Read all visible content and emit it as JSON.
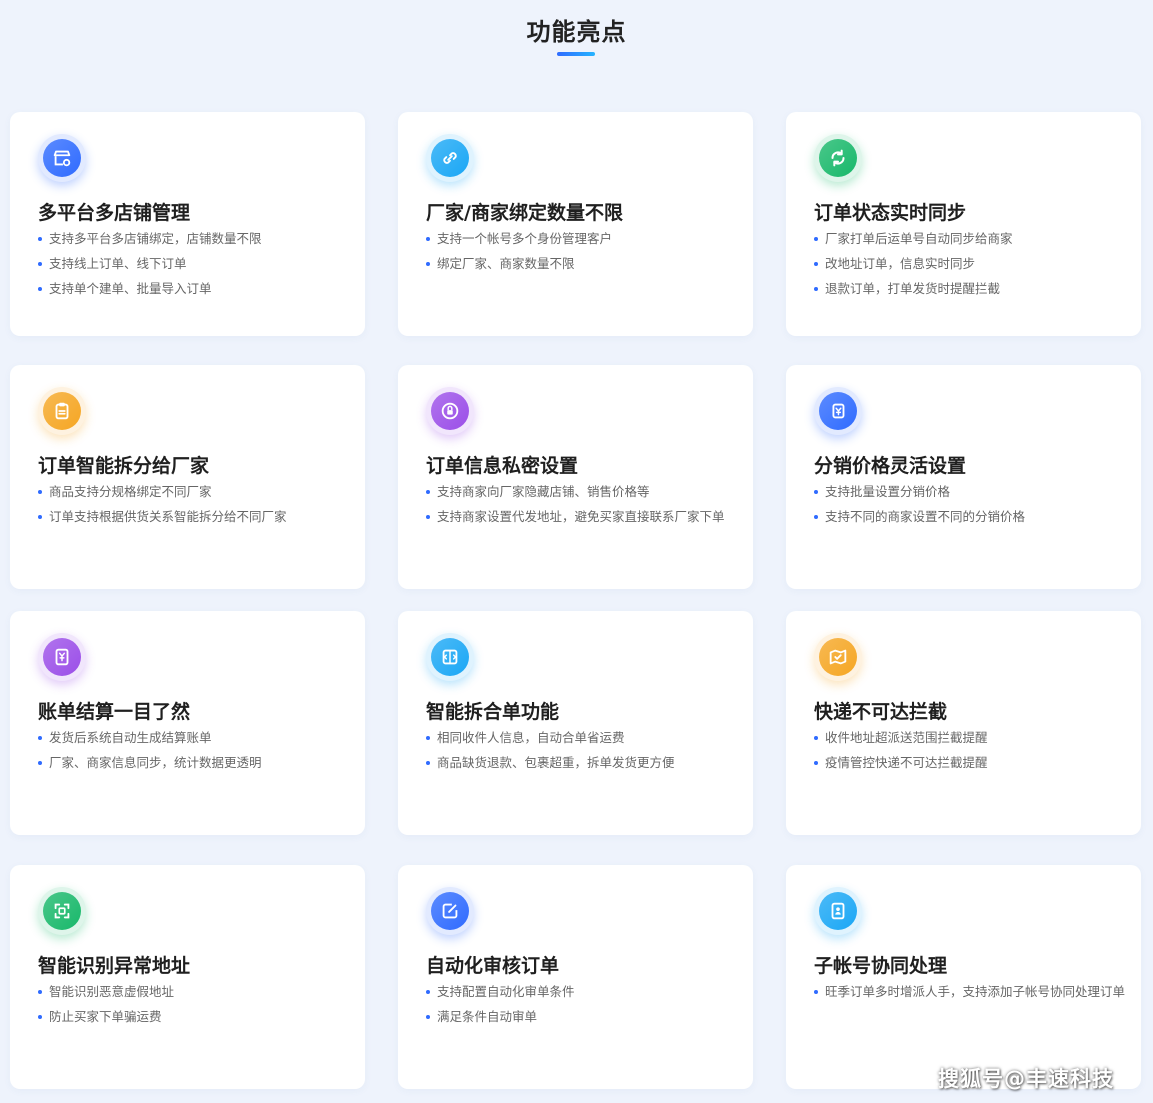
{
  "header": {
    "title": "功能亮点"
  },
  "cards": [
    {
      "title": "多平台多店铺管理",
      "icon": "store-settings-icon",
      "color": "#2f6bff",
      "bullets": [
        "支持多平台多店铺绑定，店铺数量不限",
        "支持线上订单、线下订单",
        "支持单个建单、批量导入订单"
      ]
    },
    {
      "title": "厂家/商家绑定数量不限",
      "icon": "link-icon",
      "color": "#1aa7f5",
      "bullets": [
        "支持一个帐号多个身份管理客户",
        "绑定厂家、商家数量不限"
      ]
    },
    {
      "title": "订单状态实时同步",
      "icon": "sync-icon",
      "color": "#18b86a",
      "bullets": [
        "厂家打单后运单号自动同步给商家",
        "改地址订单，信息实时同步",
        "退款订单，打单发货时提醒拦截"
      ]
    },
    {
      "title": "订单智能拆分给厂家",
      "icon": "clipboard-icon",
      "color": "#f5a623",
      "bullets": [
        "商品支持分规格绑定不同厂家",
        "订单支持根据供货关系智能拆分给不同厂家"
      ]
    },
    {
      "title": "订单信息私密设置",
      "icon": "privacy-lock-icon",
      "color": "#9b4ee8",
      "bullets": [
        "支持商家向厂家隐藏店铺、销售价格等",
        "支持商家设置代发地址，避免买家直接联系厂家下单"
      ]
    },
    {
      "title": "分销价格灵活设置",
      "icon": "price-tag-icon",
      "color": "#2f6bff",
      "bullets": [
        "支持批量设置分销价格",
        "支持不同的商家设置不同的分销价格"
      ]
    },
    {
      "title": "账单结算一目了然",
      "icon": "bill-icon",
      "color": "#9b4ee8",
      "bullets": [
        "发货后系统自动生成结算账单",
        "厂家、商家信息同步，统计数据更透明"
      ]
    },
    {
      "title": "智能拆合单功能",
      "icon": "split-merge-icon",
      "color": "#1aa7f5",
      "bullets": [
        "相同收件人信息，自动合单省运费",
        "商品缺货退款、包裹超重，拆单发货更方便"
      ]
    },
    {
      "title": "快递不可达拦截",
      "icon": "map-check-icon",
      "color": "#f5a623",
      "bullets": [
        "收件地址超派送范围拦截提醒",
        "疫情管控快递不可达拦截提醒"
      ]
    },
    {
      "title": "智能识别异常地址",
      "icon": "scan-icon",
      "color": "#18b86a",
      "bullets": [
        "智能识别恶意虚假地址",
        "防止买家下单骗运费"
      ]
    },
    {
      "title": "自动化审核订单",
      "icon": "edit-doc-icon",
      "color": "#2f6bff",
      "bullets": [
        "支持配置自动化审单条件",
        "满足条件自动审单"
      ]
    },
    {
      "title": "子帐号协同处理",
      "icon": "sub-account-icon",
      "color": "#1aa7f5",
      "bullets": [
        "旺季订单多时增派人手，支持添加子帐号协同处理订单"
      ]
    }
  ],
  "watermark": "搜狐号@丰速科技"
}
